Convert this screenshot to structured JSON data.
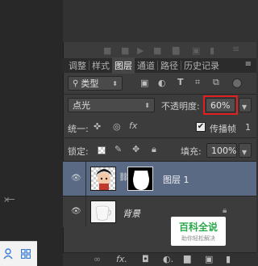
{
  "tabs": [
    {
      "label": "调整"
    },
    {
      "label": "样式"
    },
    {
      "label": "图层"
    },
    {
      "label": "通道"
    },
    {
      "label": "路径"
    },
    {
      "label": "历史记录"
    }
  ],
  "filter": {
    "kind_label": "类型"
  },
  "blend": {
    "mode": "点光",
    "opacity_label": "不透明度:",
    "opacity_value": "60%"
  },
  "unify": {
    "label": "统一:",
    "propagate_label": "传播帧",
    "propagate_checked": true,
    "frame_number": "1"
  },
  "lock": {
    "label": "锁定:",
    "fill_label": "填充:",
    "fill_value": "100%"
  },
  "layers": [
    {
      "name": "图层 1",
      "selected": true,
      "visible": true,
      "has_mask": true
    },
    {
      "name": "背景",
      "selected": false,
      "visible": true,
      "locked": true
    }
  ],
  "watermark": {
    "title": "百科全说",
    "subtitle": "助你轻松解决"
  },
  "colors": {
    "accent_red": "#e02020",
    "selected_layer": "#5a6a85",
    "watermark_green": "#2aa84a"
  }
}
